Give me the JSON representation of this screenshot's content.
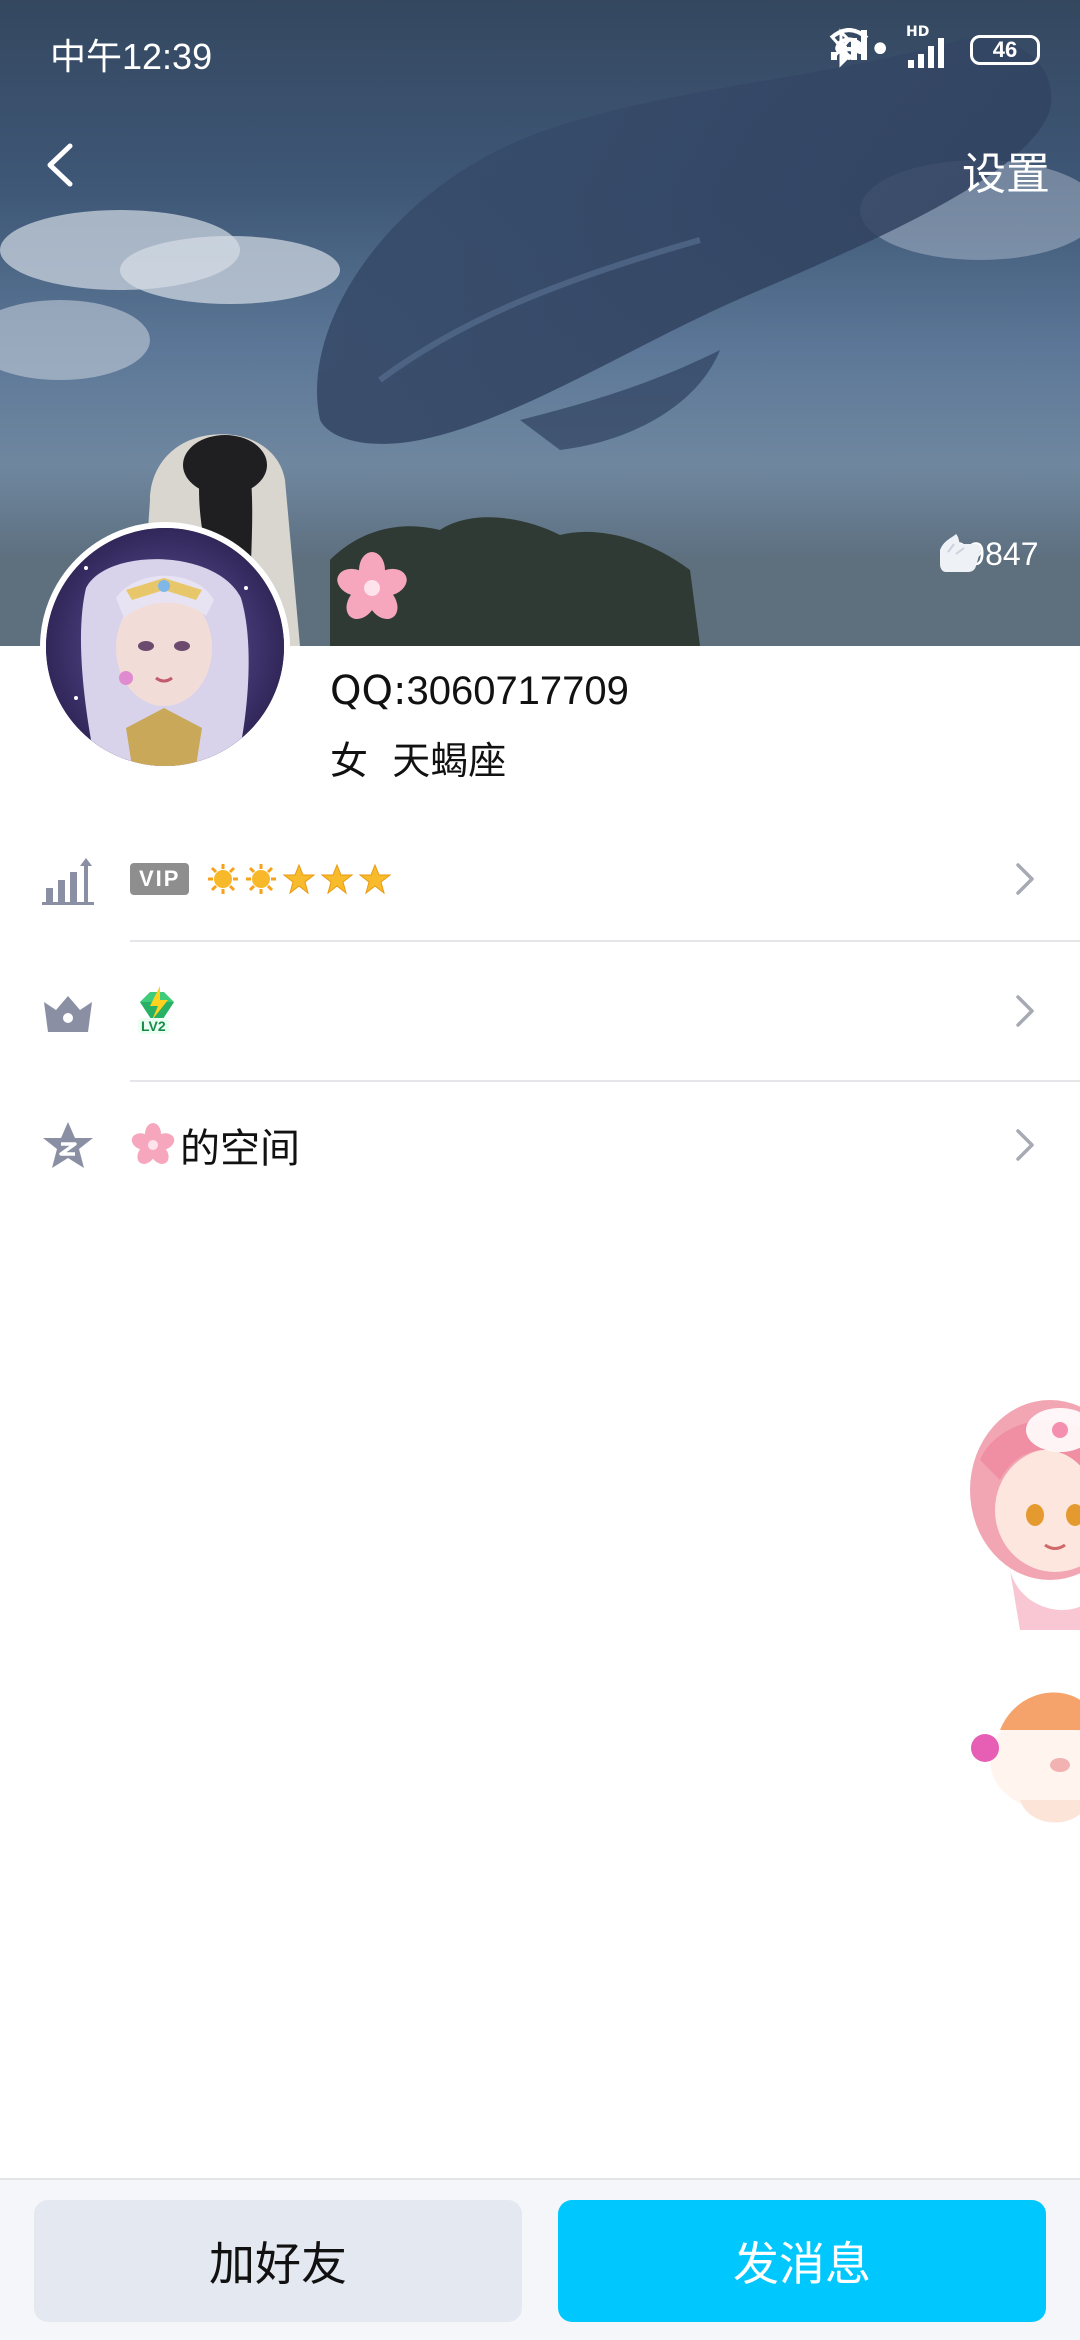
{
  "status_bar": {
    "time": "中午12:39",
    "battery": "46",
    "signal_label": "HD"
  },
  "header": {
    "back_icon": "chevron-left-icon",
    "settings_label": "设置"
  },
  "cover": {
    "likes_icon": "like-hand-icon",
    "likes_count": "39847"
  },
  "profile": {
    "qq_prefix": "QQ:",
    "qq_number": "3060717709",
    "gender": "女",
    "zodiac": "天蝎座",
    "nickname_badge_icon": "cherry-blossom-icon"
  },
  "rows": [
    {
      "icon": "level-chart-icon",
      "vip_tag": "VIP",
      "stars": [
        "sun",
        "sun",
        "star",
        "star",
        "star"
      ]
    },
    {
      "icon": "crown-icon",
      "badge": "LV2",
      "badge_icon": "green-gem-lightning-icon"
    },
    {
      "icon": "qzone-star-icon",
      "label": "的空间",
      "label_icon": "cherry-blossom-icon"
    }
  ],
  "actions": {
    "add_friend": "加好友",
    "send_message": "发消息"
  },
  "colors": {
    "primary": "#00c8ff",
    "secondary_button": "#e4e8f1",
    "icon_gray": "#8a8fa3"
  }
}
